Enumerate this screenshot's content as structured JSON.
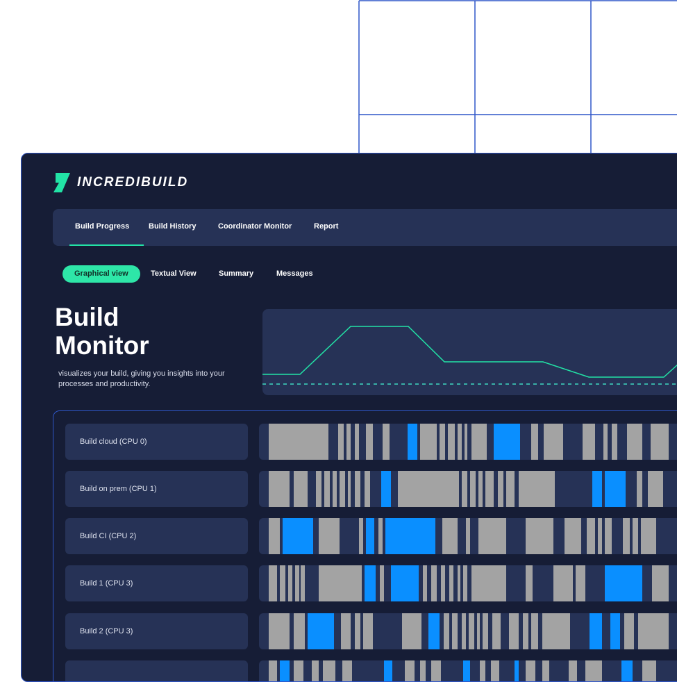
{
  "brand": {
    "name": "INCREDIBUILD",
    "accent": "#22e3a6"
  },
  "top_nav": {
    "tabs": [
      {
        "label": "Build Progress",
        "active": true
      },
      {
        "label": "Build History",
        "active": false
      },
      {
        "label": "Coordinator Monitor",
        "active": false
      },
      {
        "label": "Report",
        "active": false
      }
    ]
  },
  "sub_nav": {
    "tabs": [
      {
        "label": "Graphical view",
        "active": true
      },
      {
        "label": "Textual View",
        "active": false
      },
      {
        "label": "Summary",
        "active": false
      },
      {
        "label": "Messages",
        "active": false
      }
    ]
  },
  "hero": {
    "title_line1": "Build",
    "title_line2": "Monitor",
    "description": "visualizes your build, giving you insights into your processes and productivity."
  },
  "colors": {
    "task_gray": "#a3a3a3",
    "task_blue": "#0a8fff",
    "graph_line": "#22e3a6",
    "baseline": "#3fd9c2"
  },
  "rows": [
    {
      "label": "Build cloud (CPU 0)"
    },
    {
      "label": "Build on prem (CPU 1)"
    },
    {
      "label": "Build CI (CPU 2)"
    },
    {
      "label": "Build 1 (CPU 3)"
    },
    {
      "label": "Build 2 (CPU 3)"
    },
    {
      "label": ""
    }
  ]
}
